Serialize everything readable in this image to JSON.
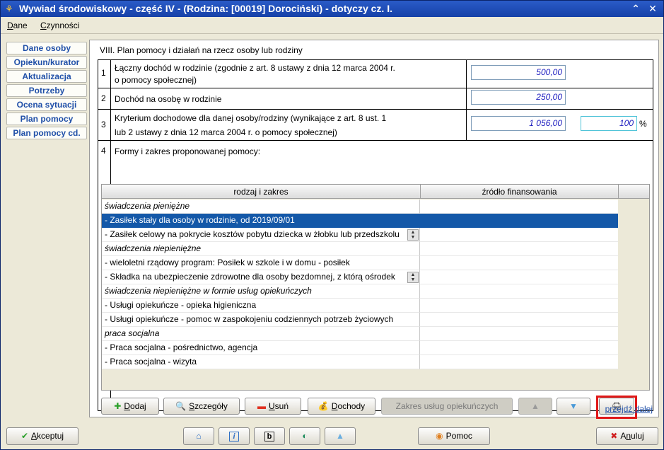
{
  "window": {
    "title": "Wywiad środowiskowy - część IV - (Rodzina: [00019] Dorociński) - dotyczy cz. I.",
    "min_glyph": "⌃",
    "close_glyph": "✕"
  },
  "menu": {
    "dane": {
      "u": "D",
      "rest": "ane"
    },
    "czynnosci": {
      "u": "C",
      "rest": "zynności"
    }
  },
  "sidebar": {
    "items": [
      {
        "label": "Dane osoby"
      },
      {
        "label": "Opiekun/kurator"
      },
      {
        "label": "Aktualizacja"
      },
      {
        "label": "Potrzeby"
      },
      {
        "label": "Ocena sytuacji"
      },
      {
        "label": "Plan pomocy"
      },
      {
        "label": "Plan pomocy cd."
      }
    ]
  },
  "section": {
    "title": "VIII. Plan pomocy i działań na rzecz osoby lub rodziny",
    "rows": [
      {
        "num": "1",
        "text_l1": "Łączny dochód w rodzinie (zgodnie z art. 8  ustawy z dnia 12 marca 2004 r.",
        "text_l2": "o pomocy społecznej)",
        "value": "500,00"
      },
      {
        "num": "2",
        "text_l1": "Dochód na osobę w rodzinie",
        "value": "250,00"
      },
      {
        "num": "3",
        "text_l1": "Kryterium dochodowe dla danej osoby/rodziny (wynikające z art. 8 ust. 1",
        "text_l2": "lub 2 ustawy z dnia 12 marca 2004 r. o pomocy społecznej)",
        "value": "1 056,00",
        "percent": "100",
        "percent_unit": "%"
      },
      {
        "num": "4",
        "text_l1": "Formy i zakres proponowanej pomocy:"
      }
    ]
  },
  "grid": {
    "headers": [
      "rodzaj i zakres",
      "źródło finansowania"
    ],
    "rows": [
      {
        "text": "świadczenia pieniężne"
      },
      {
        "text": " - Zasiłek stały dla osoby w rodzinie,  od 2019/09/01"
      },
      {
        "text": " - Zasiłek celowy na pokrycie kosztów pobytu dziecka w żłobku lub przedszkolu"
      },
      {
        "text": "świadczenia niepieniężne"
      },
      {
        "text": " - wieloletni rządowy program: Posiłek w szkole i w domu - posiłek"
      },
      {
        "text": " - Składka na ubezpieczenie zdrowotne dla osoby bezdomnej, z którą ośrodek"
      },
      {
        "text": "świadczenia niepieniężne w formie usług opiekuńczych"
      },
      {
        "text": " - Usługi opiekuńcze - opieka higieniczna"
      },
      {
        "text": " - Usługi opiekuńcze - pomoc w zaspokojeniu codziennych potrzeb życiowych"
      },
      {
        "text": "praca socjalna"
      },
      {
        "text": " - Praca socjalna - pośrednictwo, agencja"
      },
      {
        "text": " - Praca socjalna - wizyta"
      }
    ]
  },
  "buttons": {
    "dodaj": {
      "u": "D",
      "rest": "odaj"
    },
    "szczegoly": {
      "u": "S",
      "rest": "zczegóły"
    },
    "usun": {
      "u": "U",
      "rest": "suń"
    },
    "dochody": {
      "u": "D",
      "rest": "ochody"
    },
    "zakres": "Zakres usług opiekuńczych",
    "przejdz": "przejdź dalej",
    "akceptuj": {
      "u": "A",
      "rest": "kceptuj"
    },
    "pomoc": "Pomoc",
    "anuluj": {
      "pre": "A",
      "u": "n",
      "rest": "uluj"
    }
  },
  "toolbar_glyphs": {
    "info": "i",
    "bold": "b"
  },
  "colors": {
    "title_bar": "#1f4fb4",
    "selection": "#1458a8",
    "value_text": "#2020c0",
    "highlight": "#e01818"
  }
}
